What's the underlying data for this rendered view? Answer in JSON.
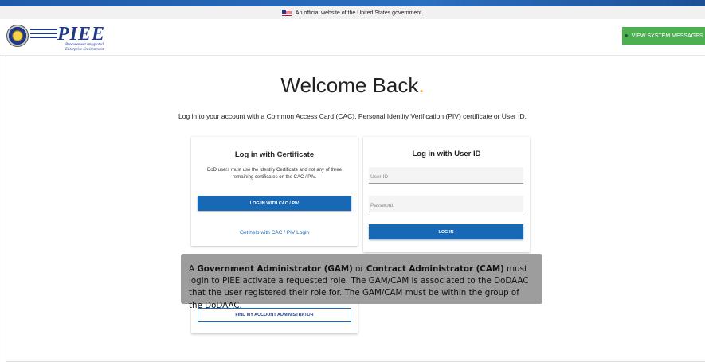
{
  "gov_banner": {
    "text": "An official website of the United States government."
  },
  "header": {
    "logo": "PIEE",
    "logo_sub_line1": "Procurement Integrated",
    "logo_sub_line2": "Enterprise Environment",
    "system_messages_label": "VIEW SYSTEM MESSAGES"
  },
  "main": {
    "welcome": "Welcome Back",
    "welcome_dot": ".",
    "subtitle": "Log in to your account with a Common Access Card (CAC), Personal Identity Verification (PIV) certificate or User ID."
  },
  "cert_card": {
    "title": "Log in with Certificate",
    "note": "DoD users must use the Identity Certificate and not any of three remaining certificates on the CAC / PIV.",
    "button": "LOG IN WITH CAC / PIV",
    "help_link": "Get help with CAC / PIV Login"
  },
  "user_card": {
    "title": "Log in with User ID",
    "user_placeholder": "User ID",
    "password_placeholder": "Password",
    "button": "LOG IN"
  },
  "admin_card": {
    "button": "FIND MY ACCOUNT ADMINISTRATOR"
  },
  "tooltip": {
    "p1": "A ",
    "gam": "Government Administrator (GAM)",
    "p2": " or ",
    "cam": "Contract Administrator (CAM)",
    "p3": " must login to PIEE activate a requested role. The GAM/CAM is associated to the DoDAAC that the user registered their role for. The GAM/CAM must be within the group of the DoDAAC."
  },
  "colors": {
    "accent": "#f5a623",
    "primary_blue": "#1769b5",
    "brand_navy": "#1f3a8a",
    "system_button_green": "#4caf50"
  }
}
